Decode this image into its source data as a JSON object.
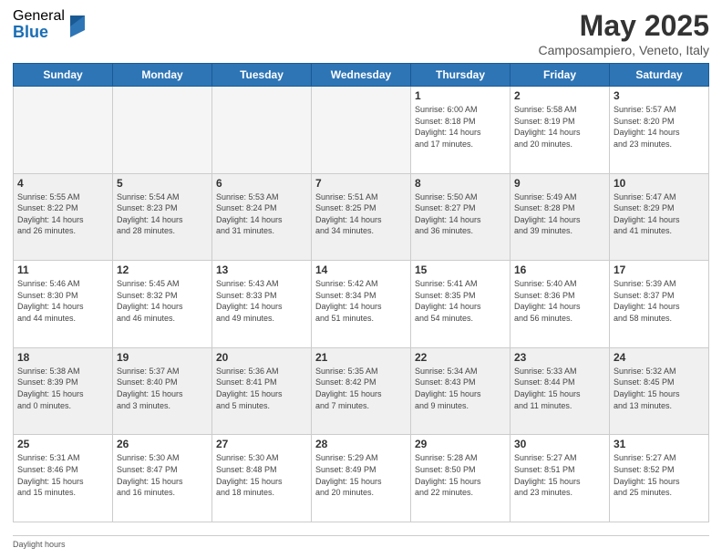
{
  "logo": {
    "general": "General",
    "blue": "Blue"
  },
  "header": {
    "month": "May 2025",
    "location": "Camposampiero, Veneto, Italy"
  },
  "days_of_week": [
    "Sunday",
    "Monday",
    "Tuesday",
    "Wednesday",
    "Thursday",
    "Friday",
    "Saturday"
  ],
  "weeks": [
    [
      {
        "day": "",
        "info": "",
        "empty": true
      },
      {
        "day": "",
        "info": "",
        "empty": true
      },
      {
        "day": "",
        "info": "",
        "empty": true
      },
      {
        "day": "",
        "info": "",
        "empty": true
      },
      {
        "day": "1",
        "info": "Sunrise: 6:00 AM\nSunset: 8:18 PM\nDaylight: 14 hours\nand 17 minutes."
      },
      {
        "day": "2",
        "info": "Sunrise: 5:58 AM\nSunset: 8:19 PM\nDaylight: 14 hours\nand 20 minutes."
      },
      {
        "day": "3",
        "info": "Sunrise: 5:57 AM\nSunset: 8:20 PM\nDaylight: 14 hours\nand 23 minutes."
      }
    ],
    [
      {
        "day": "4",
        "info": "Sunrise: 5:55 AM\nSunset: 8:22 PM\nDaylight: 14 hours\nand 26 minutes."
      },
      {
        "day": "5",
        "info": "Sunrise: 5:54 AM\nSunset: 8:23 PM\nDaylight: 14 hours\nand 28 minutes."
      },
      {
        "day": "6",
        "info": "Sunrise: 5:53 AM\nSunset: 8:24 PM\nDaylight: 14 hours\nand 31 minutes."
      },
      {
        "day": "7",
        "info": "Sunrise: 5:51 AM\nSunset: 8:25 PM\nDaylight: 14 hours\nand 34 minutes."
      },
      {
        "day": "8",
        "info": "Sunrise: 5:50 AM\nSunset: 8:27 PM\nDaylight: 14 hours\nand 36 minutes."
      },
      {
        "day": "9",
        "info": "Sunrise: 5:49 AM\nSunset: 8:28 PM\nDaylight: 14 hours\nand 39 minutes."
      },
      {
        "day": "10",
        "info": "Sunrise: 5:47 AM\nSunset: 8:29 PM\nDaylight: 14 hours\nand 41 minutes."
      }
    ],
    [
      {
        "day": "11",
        "info": "Sunrise: 5:46 AM\nSunset: 8:30 PM\nDaylight: 14 hours\nand 44 minutes."
      },
      {
        "day": "12",
        "info": "Sunrise: 5:45 AM\nSunset: 8:32 PM\nDaylight: 14 hours\nand 46 minutes."
      },
      {
        "day": "13",
        "info": "Sunrise: 5:43 AM\nSunset: 8:33 PM\nDaylight: 14 hours\nand 49 minutes."
      },
      {
        "day": "14",
        "info": "Sunrise: 5:42 AM\nSunset: 8:34 PM\nDaylight: 14 hours\nand 51 minutes."
      },
      {
        "day": "15",
        "info": "Sunrise: 5:41 AM\nSunset: 8:35 PM\nDaylight: 14 hours\nand 54 minutes."
      },
      {
        "day": "16",
        "info": "Sunrise: 5:40 AM\nSunset: 8:36 PM\nDaylight: 14 hours\nand 56 minutes."
      },
      {
        "day": "17",
        "info": "Sunrise: 5:39 AM\nSunset: 8:37 PM\nDaylight: 14 hours\nand 58 minutes."
      }
    ],
    [
      {
        "day": "18",
        "info": "Sunrise: 5:38 AM\nSunset: 8:39 PM\nDaylight: 15 hours\nand 0 minutes."
      },
      {
        "day": "19",
        "info": "Sunrise: 5:37 AM\nSunset: 8:40 PM\nDaylight: 15 hours\nand 3 minutes."
      },
      {
        "day": "20",
        "info": "Sunrise: 5:36 AM\nSunset: 8:41 PM\nDaylight: 15 hours\nand 5 minutes."
      },
      {
        "day": "21",
        "info": "Sunrise: 5:35 AM\nSunset: 8:42 PM\nDaylight: 15 hours\nand 7 minutes."
      },
      {
        "day": "22",
        "info": "Sunrise: 5:34 AM\nSunset: 8:43 PM\nDaylight: 15 hours\nand 9 minutes."
      },
      {
        "day": "23",
        "info": "Sunrise: 5:33 AM\nSunset: 8:44 PM\nDaylight: 15 hours\nand 11 minutes."
      },
      {
        "day": "24",
        "info": "Sunrise: 5:32 AM\nSunset: 8:45 PM\nDaylight: 15 hours\nand 13 minutes."
      }
    ],
    [
      {
        "day": "25",
        "info": "Sunrise: 5:31 AM\nSunset: 8:46 PM\nDaylight: 15 hours\nand 15 minutes."
      },
      {
        "day": "26",
        "info": "Sunrise: 5:30 AM\nSunset: 8:47 PM\nDaylight: 15 hours\nand 16 minutes."
      },
      {
        "day": "27",
        "info": "Sunrise: 5:30 AM\nSunset: 8:48 PM\nDaylight: 15 hours\nand 18 minutes."
      },
      {
        "day": "28",
        "info": "Sunrise: 5:29 AM\nSunset: 8:49 PM\nDaylight: 15 hours\nand 20 minutes."
      },
      {
        "day": "29",
        "info": "Sunrise: 5:28 AM\nSunset: 8:50 PM\nDaylight: 15 hours\nand 22 minutes."
      },
      {
        "day": "30",
        "info": "Sunrise: 5:27 AM\nSunset: 8:51 PM\nDaylight: 15 hours\nand 23 minutes."
      },
      {
        "day": "31",
        "info": "Sunrise: 5:27 AM\nSunset: 8:52 PM\nDaylight: 15 hours\nand 25 minutes."
      }
    ]
  ],
  "footer": {
    "daylight_note": "Daylight hours"
  }
}
